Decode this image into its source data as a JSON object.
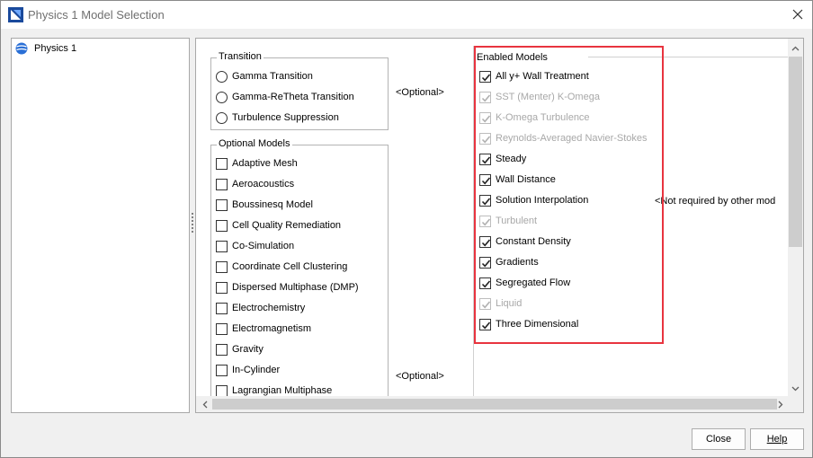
{
  "window": {
    "title": "Physics 1 Model Selection"
  },
  "tree": {
    "items": [
      {
        "label": "Physics 1"
      }
    ]
  },
  "transition": {
    "title": "Transition",
    "options": [
      "Gamma Transition",
      "Gamma-ReTheta Transition",
      "Turbulence Suppression"
    ],
    "hint": "<Optional>"
  },
  "optional_models": {
    "title": "Optional Models",
    "items": [
      "Adaptive Mesh",
      "Aeroacoustics",
      "Boussinesq Model",
      "Cell Quality Remediation",
      "Co-Simulation",
      "Coordinate Cell Clustering",
      "Dispersed Multiphase (DMP)",
      "Electrochemistry",
      "Electromagnetism",
      "Gravity",
      "In-Cylinder",
      "Lagrangian Multiphase"
    ],
    "hint": "<Optional>"
  },
  "enabled_models": {
    "title": "Enabled Models",
    "items": [
      {
        "label": "All y+ Wall Treatment",
        "checked": true,
        "enabled": true
      },
      {
        "label": "SST (Menter) K-Omega",
        "checked": true,
        "enabled": false
      },
      {
        "label": "K-Omega Turbulence",
        "checked": true,
        "enabled": false
      },
      {
        "label": "Reynolds-Averaged Navier-Stokes",
        "checked": true,
        "enabled": false
      },
      {
        "label": "Steady",
        "checked": true,
        "enabled": true
      },
      {
        "label": "Wall Distance",
        "checked": true,
        "enabled": true
      },
      {
        "label": "Solution Interpolation",
        "checked": true,
        "enabled": true
      },
      {
        "label": "Turbulent",
        "checked": true,
        "enabled": false
      },
      {
        "label": "Constant Density",
        "checked": true,
        "enabled": true
      },
      {
        "label": "Gradients",
        "checked": true,
        "enabled": true
      },
      {
        "label": "Segregated Flow",
        "checked": true,
        "enabled": true
      },
      {
        "label": "Liquid",
        "checked": true,
        "enabled": false
      },
      {
        "label": "Three Dimensional",
        "checked": true,
        "enabled": true
      }
    ],
    "note": "<Not required by other mod"
  },
  "buttons": {
    "close": "Close",
    "help": "Help"
  },
  "colors": {
    "highlight_box": "#e8343f",
    "disabled_text": "#a8a8a8",
    "app_icon": "#1a4a9c",
    "physics_icon": "#2a6fd6"
  },
  "icons": {
    "app": "app-logo-icon",
    "physics": "physics-continuum-icon",
    "close": "close-icon"
  }
}
